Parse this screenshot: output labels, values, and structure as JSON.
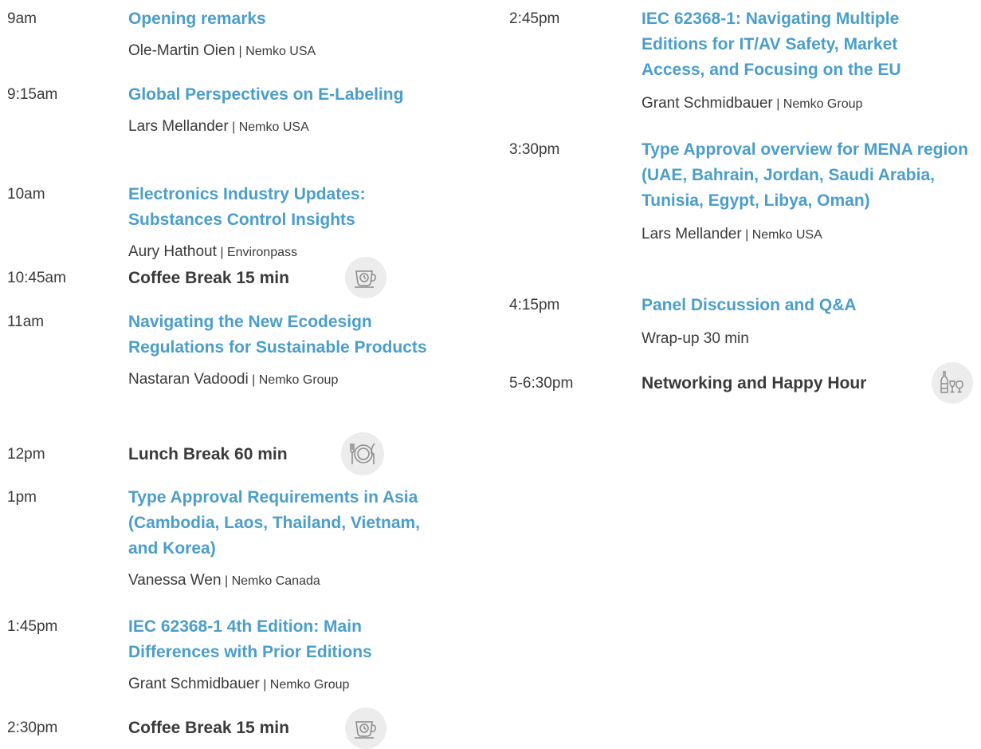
{
  "left_column": [
    {
      "time": "9am",
      "title": "Opening remarks",
      "speaker": "Ole-Martin Oien",
      "org": "Nemko USA"
    },
    {
      "time": "9:15am",
      "title": "Global Perspectives on E-Labeling",
      "speaker": "Lars Mellander",
      "org": "Nemko USA"
    },
    {
      "time": "10am",
      "title": "Electronics Industry Updates: Substances Control Insights",
      "speaker": "Aury Hathout",
      "org": "Environpass"
    },
    {
      "time": "10:45am",
      "break_label": "Coffee Break 15 min",
      "icon": "coffee-cup-icon"
    },
    {
      "time": "11am",
      "title": "Navigating the New Ecodesign Regulations for Sustainable Products",
      "speaker": "Nastaran Vadoodi",
      "org": "Nemko Group"
    },
    {
      "time": "12pm",
      "break_label": "Lunch Break 60 min",
      "icon": "plate-cutlery-icon"
    },
    {
      "time": "1pm",
      "title": "Type Approval Requirements in Asia (Cambodia, Laos, Thailand, Vietnam, and Korea)",
      "speaker": "Vanessa Wen",
      "org": "Nemko Canada"
    },
    {
      "time": "1:45pm",
      "title": "IEC 62368-1 4th Edition: Main Differences with Prior Editions",
      "speaker": "Grant Schmidbauer",
      "org": "Nemko Group"
    },
    {
      "time": "2:30pm",
      "break_label": "Coffee Break 15 min",
      "icon": "coffee-cup-icon"
    }
  ],
  "right_column": [
    {
      "time": "2:45pm",
      "title": "IEC 62368-1: Navigating Multiple Editions for IT/AV Safety, Market Access, and Focusing on the EU",
      "speaker": "Grant Schmidbauer",
      "org": "Nemko Group"
    },
    {
      "time": "3:30pm",
      "title": "Type Approval overview for MENA region (UAE, Bahrain, Jordan, Saudi Arabia, Tunisia, Egypt, Libya, Oman)",
      "speaker": "Lars Mellander",
      "org": "Nemko USA"
    },
    {
      "time": "4:15pm",
      "title": "Panel Discussion and Q&A",
      "subtitle": "Wrap-up 30 min"
    },
    {
      "time": "5-6:30pm",
      "break_label": "Networking and Happy Hour",
      "icon": "wine-glasses-icon"
    }
  ],
  "separator": " | ",
  "colors": {
    "title": "#4a9ec9",
    "text": "#3a3a3a",
    "icon_bg": "#ececec",
    "icon_stroke": "#8a8a8a"
  }
}
